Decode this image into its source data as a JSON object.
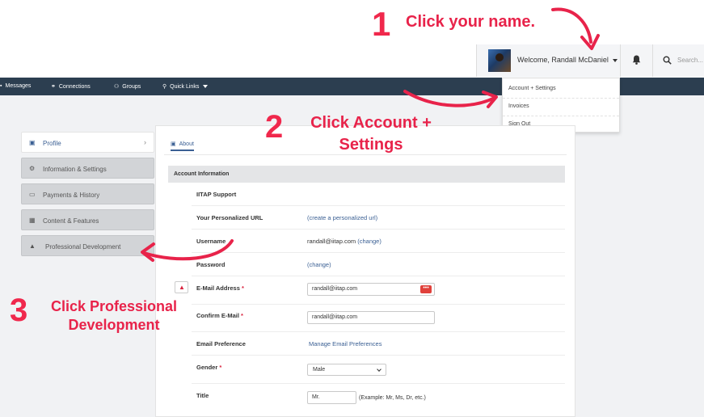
{
  "header": {
    "welcome_text": "Welcome, Randall McDaniel",
    "search_placeholder": "Search..."
  },
  "nav": {
    "items": [
      {
        "label": "Messages",
        "icon": "chat-icon"
      },
      {
        "label": "Connections",
        "icon": "connections-icon"
      },
      {
        "label": "Groups",
        "icon": "groups-icon"
      },
      {
        "label": "Quick Links",
        "icon": "link-icon"
      }
    ]
  },
  "user_menu": {
    "items": [
      "Account + Settings",
      "Invoices",
      "Sign Out"
    ]
  },
  "sidebar": {
    "items": [
      {
        "label": "Profile",
        "icon": "profile-icon"
      },
      {
        "label": "Information & Settings",
        "icon": "gears-icon"
      },
      {
        "label": "Payments & History",
        "icon": "money-icon"
      },
      {
        "label": "Content & Features",
        "icon": "grid-icon"
      },
      {
        "label": "Professional Development",
        "icon": "graduation-cap-icon"
      }
    ]
  },
  "profile": {
    "tab_about": "About",
    "section_title": "Account Information",
    "org": "IITAP Support",
    "url_label": "Your Personalized URL",
    "url_value": "(create a personalized url)",
    "username_label": "Username",
    "username_value": "randall@iitap.com",
    "username_change": "(change)",
    "password_label": "Password",
    "password_change": "(change)",
    "email_label": "E-Mail Address",
    "email_value": "randall@iitap.com",
    "confirm_email_label": "Confirm E-Mail",
    "confirm_email_value": "randall@iitap.com",
    "email_pref_label": "Email Preference",
    "email_pref_link": "Manage Email Preferences",
    "gender_label": "Gender",
    "gender_value": "Male",
    "title_label": "Title",
    "title_value": "Mr.",
    "title_hint": "(Example: Mr, Ms, Dr, etc.)",
    "required_mark": "*"
  },
  "annotations": {
    "step1_num": "1",
    "step1_text": "Click your name.",
    "step2_num": "2",
    "step2_line1": "Click Account +",
    "step2_line2": "Settings",
    "step3_num": "3",
    "step3_line1": "Click Professional",
    "step3_line2": "Development",
    "color": "#e8234a"
  }
}
